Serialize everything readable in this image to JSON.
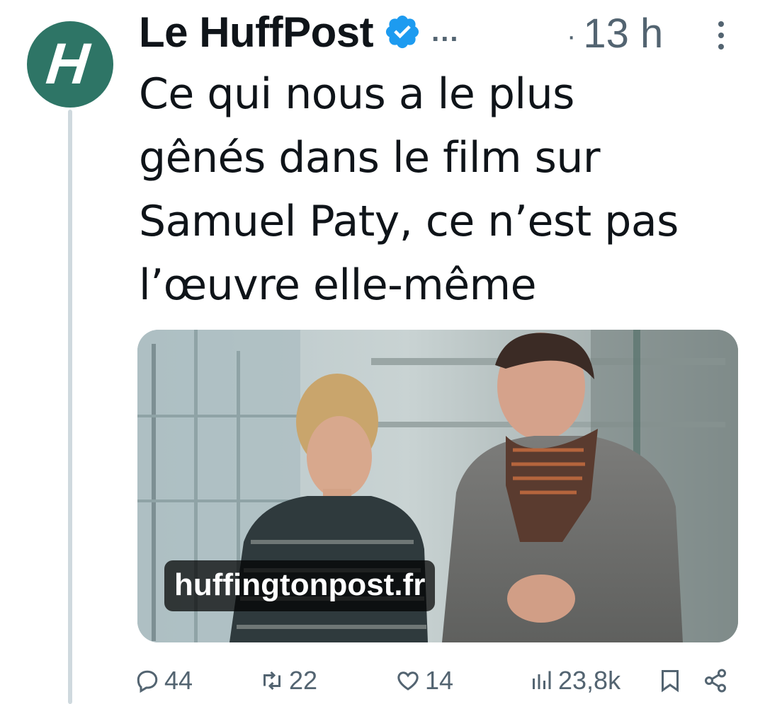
{
  "author": {
    "avatar_letter": "H",
    "name": "Le HuffPost",
    "handle_truncated": "...",
    "time": "13 h",
    "time_separator": "·"
  },
  "tweet": {
    "text_lines": [
      "Ce qui nous a le plus",
      "gênés dans le film sur",
      "Samuel Paty, ce n’est pas",
      "l’œuvre elle-même"
    ]
  },
  "card": {
    "domain": "huffingtonpost.fr"
  },
  "actions": {
    "replies": "44",
    "retweets": "22",
    "likes": "14",
    "views": "23,8k"
  },
  "colors": {
    "avatar_bg": "#2e7566",
    "verified": "#1d9bf0",
    "muted": "#536471",
    "thread_line": "#cfd9de"
  },
  "icons": [
    "verified-badge-icon",
    "more-icon",
    "reply-icon",
    "retweet-icon",
    "like-icon",
    "views-icon",
    "bookmark-icon",
    "share-icon"
  ]
}
